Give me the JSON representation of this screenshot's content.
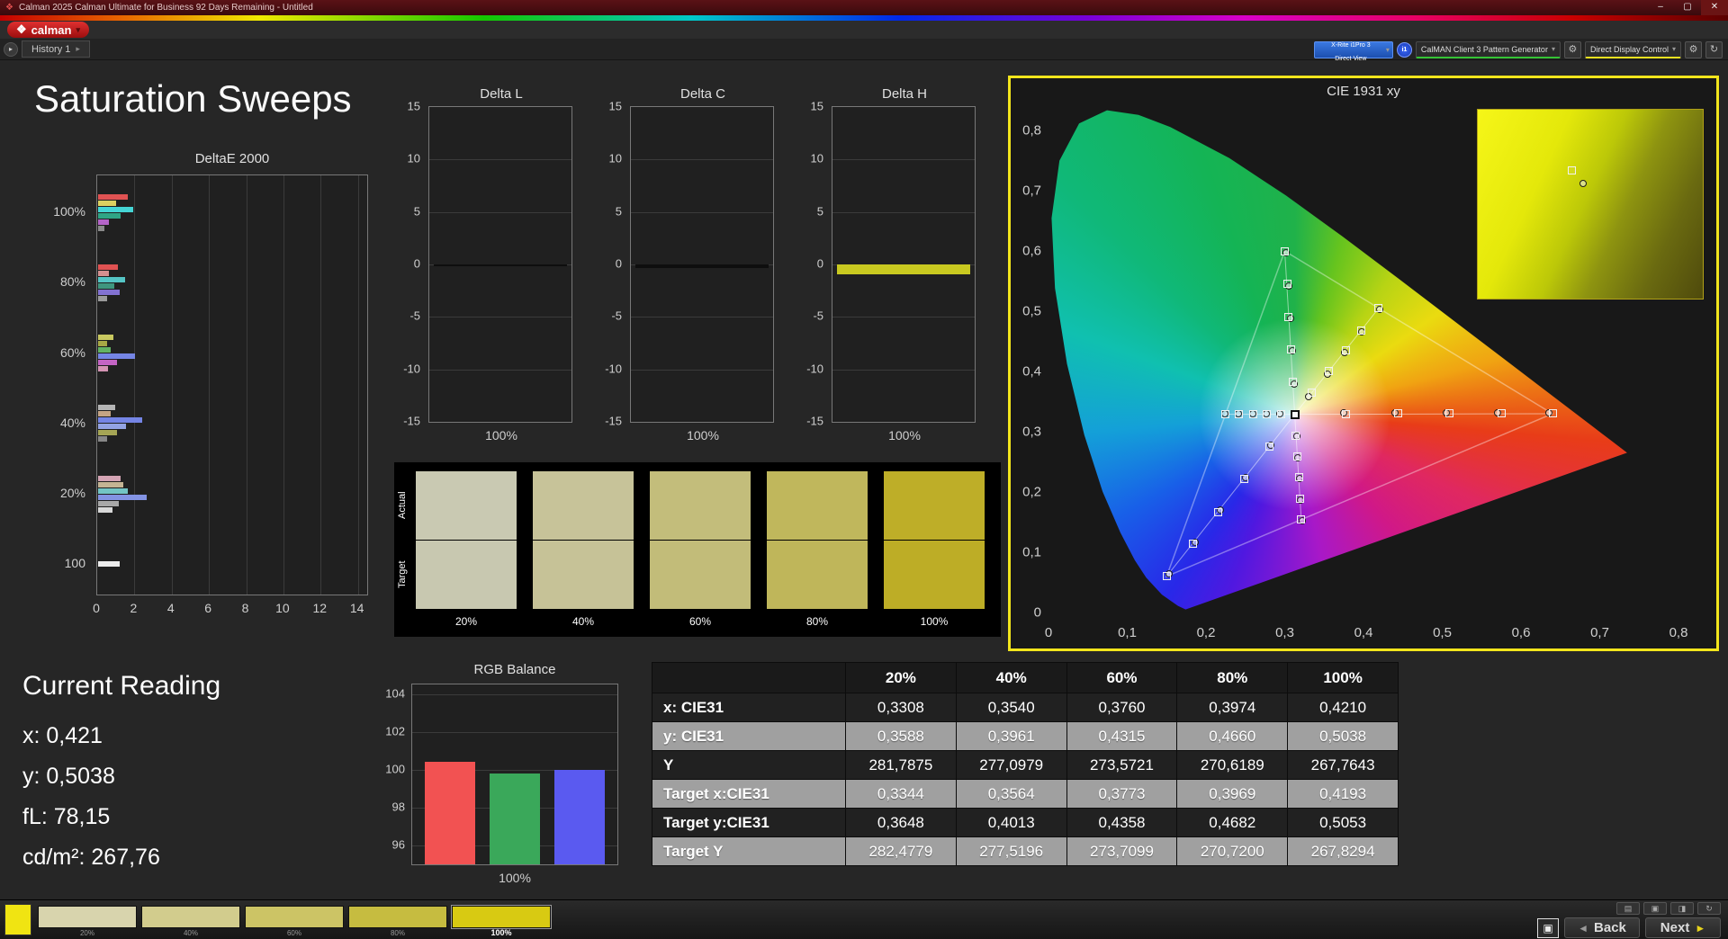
{
  "titlebar": {
    "title": "Calman 2025 Calman Ultimate for Business 92 Days Remaining  - Untitled"
  },
  "icons": {
    "logo": "❖",
    "caret_down": "▾",
    "caret_right": "▸",
    "nav_play": "▸",
    "gear": "⚙",
    "refresh": "↻",
    "grid": "▤",
    "pattern": "▣",
    "half": "◨",
    "back_arrow": "◄",
    "next_arrow": "►",
    "minimize": "–",
    "maximize": "▢",
    "close": "✕"
  },
  "logo": {
    "text": "calman"
  },
  "tabs": {
    "history_label": "History 1"
  },
  "devices": {
    "meter_line1": "X-Rite i1Pro 3",
    "meter_line2": "Direct View",
    "badge_text": "i1",
    "pattern_generator_label": "CalMAN Client 3 Pattern Generator",
    "display_control_label": "Direct Display Control"
  },
  "page": {
    "title": "Saturation Sweeps"
  },
  "charts": {
    "deltae": {
      "title": "DeltaE 2000",
      "x_ticks": [
        0,
        2,
        4,
        6,
        8,
        10,
        12,
        14
      ],
      "x_max": 14.5,
      "groups": [
        {
          "label": "100%",
          "bars": [
            {
              "color": "#e05252",
              "v": 1.6
            },
            {
              "color": "#ddd060",
              "v": 0.95
            },
            {
              "color": "#45d5d5",
              "v": 1.9
            },
            {
              "color": "#2fa585",
              "v": 1.2
            },
            {
              "color": "#b464c8",
              "v": 0.6
            },
            {
              "color": "#8a8a8a",
              "v": 0.35
            }
          ]
        },
        {
          "label": "80%",
          "bars": [
            {
              "color": "#e05252",
              "v": 1.05
            },
            {
              "color": "#d49090",
              "v": 0.6
            },
            {
              "color": "#55c5c5",
              "v": 1.45
            },
            {
              "color": "#3f967f",
              "v": 0.85
            },
            {
              "color": "#8272d2",
              "v": 1.15
            },
            {
              "color": "#9a9a9a",
              "v": 0.5
            }
          ]
        },
        {
          "label": "60%",
          "bars": [
            {
              "color": "#c9c960",
              "v": 0.8
            },
            {
              "color": "#a8a845",
              "v": 0.5
            },
            {
              "color": "#63b363",
              "v": 0.7
            },
            {
              "color": "#7585e5",
              "v": 2.0
            },
            {
              "color": "#c464c4",
              "v": 1.0
            },
            {
              "color": "#d494b4",
              "v": 0.55
            }
          ]
        },
        {
          "label": "40%",
          "bars": [
            {
              "color": "#b5b5b5",
              "v": 0.9
            },
            {
              "color": "#c4a484",
              "v": 0.7
            },
            {
              "color": "#7585e5",
              "v": 2.35
            },
            {
              "color": "#93a3e3",
              "v": 1.5
            },
            {
              "color": "#a5a555",
              "v": 1.0
            },
            {
              "color": "#878787",
              "v": 0.5
            }
          ]
        },
        {
          "label": "20%",
          "bars": [
            {
              "color": "#d4a4b4",
              "v": 1.2
            },
            {
              "color": "#c4b494",
              "v": 1.35
            },
            {
              "color": "#73c5c5",
              "v": 1.6
            },
            {
              "color": "#8393e3",
              "v": 2.6
            },
            {
              "color": "#a8a8a8",
              "v": 1.1
            },
            {
              "color": "#d8d8d8",
              "v": 0.75
            }
          ]
        },
        {
          "label": "100",
          "bars": [
            {
              "color": "#ececec",
              "v": 1.15
            }
          ]
        }
      ]
    },
    "delta_y_ticks": [
      "15",
      "10",
      "5",
      "0",
      "-5",
      "-10",
      "-15"
    ],
    "delta_l": {
      "title": "Delta L",
      "x_label": "100%",
      "value": -0.15,
      "bar_color": "#0e0e0e"
    },
    "delta_c": {
      "title": "Delta C",
      "x_label": "100%",
      "value": -0.35,
      "bar_color": "#0e0e0e"
    },
    "delta_h": {
      "title": "Delta H",
      "x_label": "100%",
      "value": -0.9,
      "bar_color": "#c9c920"
    },
    "cie": {
      "title": "CIE 1931 xy",
      "x_tick_labels": [
        "0",
        "0,1",
        "0,2",
        "0,3",
        "0,4",
        "0,5",
        "0,6",
        "0,7",
        "0,8"
      ],
      "y_tick_labels": [
        "0",
        "0,1",
        "0,2",
        "0,3",
        "0,4",
        "0,5",
        "0,6",
        "0,7",
        "0,8"
      ],
      "white_point": [
        0.3127,
        0.329
      ],
      "gamut_triangle": [
        [
          0.64,
          0.33
        ],
        [
          0.3,
          0.6
        ],
        [
          0.15,
          0.06
        ]
      ],
      "sweeps": [
        {
          "name": "red",
          "targets": [
            [
              0.378,
              0.329
            ],
            [
              0.444,
              0.33
            ],
            [
              0.509,
              0.33
            ],
            [
              0.575,
              0.33
            ],
            [
              0.64,
              0.33
            ]
          ],
          "measured": [
            [
              0.375,
              0.331
            ],
            [
              0.44,
              0.332
            ],
            [
              0.505,
              0.331
            ],
            [
              0.57,
              0.332
            ],
            [
              0.635,
              0.331
            ]
          ]
        },
        {
          "name": "green",
          "targets": [
            [
              0.31,
              0.383
            ],
            [
              0.308,
              0.437
            ],
            [
              0.305,
              0.491
            ],
            [
              0.303,
              0.546
            ],
            [
              0.3,
              0.6
            ]
          ],
          "measured": [
            [
              0.312,
              0.38
            ],
            [
              0.31,
              0.434
            ],
            [
              0.307,
              0.488
            ],
            [
              0.305,
              0.542
            ],
            [
              0.302,
              0.597
            ]
          ]
        },
        {
          "name": "blue",
          "targets": [
            [
              0.28,
              0.275
            ],
            [
              0.248,
              0.221
            ],
            [
              0.215,
              0.167
            ],
            [
              0.183,
              0.114
            ],
            [
              0.15,
              0.06
            ]
          ],
          "measured": [
            [
              0.282,
              0.277
            ],
            [
              0.25,
              0.224
            ],
            [
              0.218,
              0.17
            ],
            [
              0.186,
              0.117
            ],
            [
              0.153,
              0.064
            ]
          ]
        },
        {
          "name": "cyan",
          "targets": [
            [
              0.295,
              0.329
            ],
            [
              0.277,
              0.329
            ],
            [
              0.26,
              0.329
            ],
            [
              0.242,
              0.329
            ],
            [
              0.225,
              0.329
            ]
          ],
          "measured": [
            [
              0.294,
              0.33
            ],
            [
              0.276,
              0.33
            ],
            [
              0.259,
              0.33
            ],
            [
              0.241,
              0.33
            ],
            [
              0.224,
              0.33
            ]
          ]
        },
        {
          "name": "magenta",
          "targets": [
            [
              0.314,
              0.294
            ],
            [
              0.316,
              0.259
            ],
            [
              0.318,
              0.224
            ],
            [
              0.319,
              0.189
            ],
            [
              0.321,
              0.154
            ]
          ],
          "measured": [
            [
              0.315,
              0.292
            ],
            [
              0.317,
              0.257
            ],
            [
              0.319,
              0.222
            ],
            [
              0.32,
              0.187
            ],
            [
              0.322,
              0.152
            ]
          ]
        },
        {
          "name": "yellow",
          "targets": [
            [
              0.3344,
              0.3648
            ],
            [
              0.3564,
              0.4013
            ],
            [
              0.3773,
              0.4358
            ],
            [
              0.3969,
              0.4682
            ],
            [
              0.4193,
              0.5053
            ]
          ],
          "measured": [
            [
              0.3308,
              0.3588
            ],
            [
              0.354,
              0.3961
            ],
            [
              0.376,
              0.4315
            ],
            [
              0.3974,
              0.466
            ],
            [
              0.421,
              0.5038
            ]
          ]
        }
      ]
    },
    "rgb": {
      "title": "RGB Balance",
      "x_label": "100%",
      "tick_labels": [
        "104",
        "102",
        "100",
        "98",
        "96"
      ],
      "range": [
        95,
        104.5
      ],
      "bars": [
        {
          "color": "#f25252",
          "value": 100.4
        },
        {
          "color": "#3aa85a",
          "value": 99.8
        },
        {
          "color": "#5a5af0",
          "value": 100.0
        }
      ]
    }
  },
  "swatches": {
    "row_labels": [
      "Actual",
      "Target"
    ],
    "items": [
      {
        "label": "20%",
        "actual": "#c9c9b2",
        "target": "#c8c8b0"
      },
      {
        "label": "40%",
        "actual": "#c7c399",
        "target": "#c6c297"
      },
      {
        "label": "60%",
        "actual": "#c3bd7b",
        "target": "#c2bc79"
      },
      {
        "label": "80%",
        "actual": "#c0b75c",
        "target": "#bfb65a"
      },
      {
        "label": "100%",
        "actual": "#beae28",
        "target": "#bdad26"
      }
    ]
  },
  "reading": {
    "title": "Current Reading",
    "lines": [
      "x: 0,421",
      "y: 0,5038",
      "fL: 78,15",
      "cd/m²: 267,76"
    ]
  },
  "table": {
    "columns": [
      "",
      "20%",
      "40%",
      "60%",
      "80%",
      "100%"
    ],
    "rows": [
      {
        "label": "x: CIE31",
        "shade": "dark",
        "values": [
          "0,3308",
          "0,3540",
          "0,3760",
          "0,3974",
          "0,4210"
        ]
      },
      {
        "label": "y: CIE31",
        "shade": "light",
        "values": [
          "0,3588",
          "0,3961",
          "0,4315",
          "0,4660",
          "0,5038"
        ]
      },
      {
        "label": "Y",
        "shade": "dark",
        "values": [
          "281,7875",
          "277,0979",
          "273,5721",
          "270,6189",
          "267,7643"
        ]
      },
      {
        "label": "Target x:CIE31",
        "shade": "light",
        "values": [
          "0,3344",
          "0,3564",
          "0,3773",
          "0,3969",
          "0,4193"
        ]
      },
      {
        "label": "Target y:CIE31",
        "shade": "dark",
        "values": [
          "0,3648",
          "0,4013",
          "0,4358",
          "0,4682",
          "0,5053"
        ]
      },
      {
        "label": "Target Y",
        "shade": "light",
        "values": [
          "282,4779",
          "277,5196",
          "273,7099",
          "270,7200",
          "267,8294"
        ]
      }
    ]
  },
  "bottombar": {
    "current_patch_color": "#f0e412",
    "swatches": [
      {
        "label": "20%",
        "color": "#d8d4ad"
      },
      {
        "label": "40%",
        "color": "#d2cc8d"
      },
      {
        "label": "60%",
        "color": "#ccc465"
      },
      {
        "label": "80%",
        "color": "#c6bc40"
      },
      {
        "label": "100%",
        "color": "#d8ca12",
        "selected": true
      }
    ],
    "back_label": "Back",
    "next_label": "Next"
  }
}
